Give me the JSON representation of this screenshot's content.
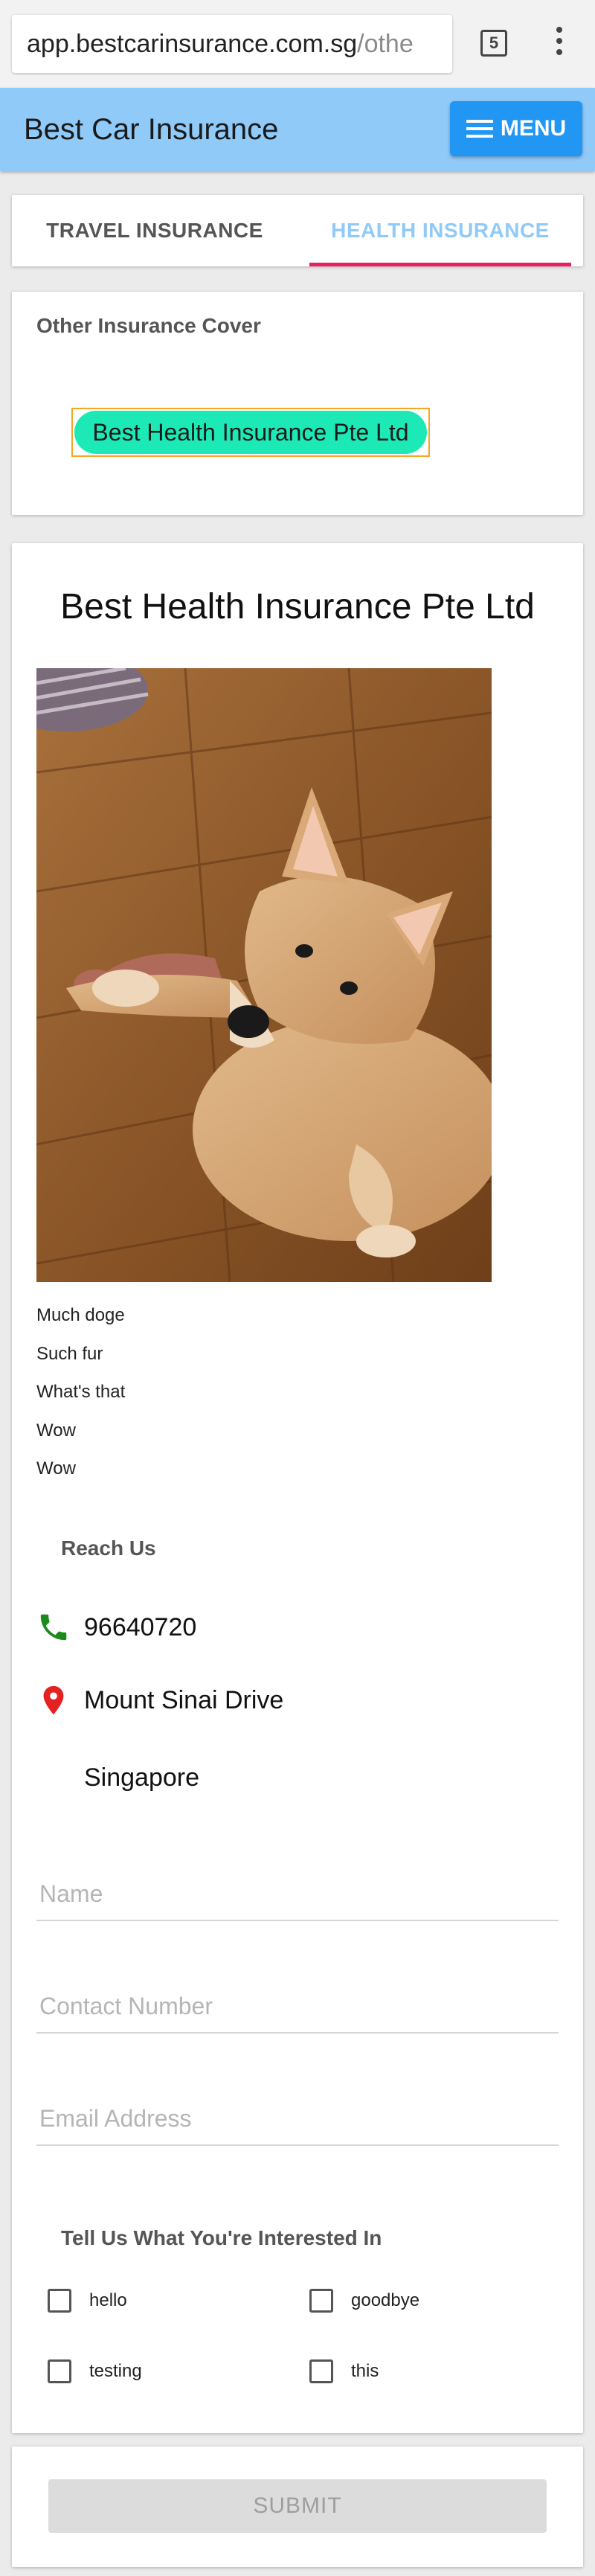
{
  "browser": {
    "url_host": "app.bestcarinsurance.com.sg",
    "url_path": "/othe",
    "tab_count": "5",
    "menu_icon": "kebab-menu-icon"
  },
  "header": {
    "title": "Best Car Insurance",
    "menu_label": "MENU",
    "color": "#90caf9",
    "button_color": "#2196f3"
  },
  "tabs": [
    {
      "label": "TRAVEL INSURANCE",
      "active": false
    },
    {
      "label": "HEALTH INSURANCE",
      "active": true
    }
  ],
  "other_cover": {
    "heading": "Other Insurance Cover",
    "chip_label": "Best Health Insurance Pte Ltd",
    "chip_color": "#1de9b6"
  },
  "detail": {
    "title": "Best Health Insurance Pte Ltd",
    "description_lines": [
      "Much doge",
      "Such fur",
      "What's that",
      "Wow",
      "Wow"
    ],
    "reach_heading": "Reach Us",
    "phone": "96640720",
    "address_line1": "Mount Sinai Drive",
    "address_line2": "Singapore",
    "phone_icon": "phone-icon",
    "location_icon": "location-pin-icon"
  },
  "form": {
    "name_placeholder": "Name",
    "contact_placeholder": "Contact Number",
    "email_placeholder": "Email Address",
    "interest_heading": "Tell Us What You're Interested In",
    "options": [
      "hello",
      "goodbye",
      "testing",
      "this"
    ],
    "submit_label": "SUBMIT"
  }
}
